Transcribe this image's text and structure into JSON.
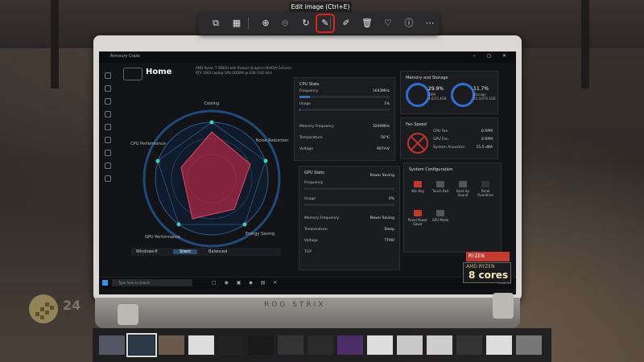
{
  "viewer": {
    "tooltip": "Edit image (Ctrl+E)",
    "toolbar": [
      {
        "name": "visual-search-icon",
        "glyph": "⧉"
      },
      {
        "name": "mosaic-icon",
        "glyph": "▦"
      },
      {
        "name": "zoom-in-icon",
        "glyph": "⊕"
      },
      {
        "name": "zoom-out-icon",
        "glyph": "⊖"
      },
      {
        "name": "rotate-icon",
        "glyph": "↻"
      },
      {
        "name": "edit-image-icon",
        "glyph": "✎"
      },
      {
        "name": "draw-icon",
        "glyph": "✐"
      },
      {
        "name": "delete-icon",
        "glyph": "🗑"
      },
      {
        "name": "favorite-icon",
        "glyph": "♡"
      },
      {
        "name": "info-icon",
        "glyph": "ⓘ"
      },
      {
        "name": "more-icon",
        "glyph": "⋯"
      }
    ],
    "selected_tool": "edit-image-icon",
    "filmstrip_count": 15,
    "filmstrip_current": 1,
    "accent": "#e0221c"
  },
  "photo": {
    "base_text": "ROG STRIX",
    "sticker_top": "AMD RYZEN",
    "sticker_main": "8 cores",
    "red_sticker": "RYZEN"
  },
  "app": {
    "title": "Armoury Crate",
    "page": "Home",
    "spec": "AMD Ryzen 7 5800H with Radeon Graphics NVIDIA GeForce RTX 3060 Laptop GPU GDDR6 @ 6GB (192 bits)",
    "radar_labels": [
      "Cooling",
      "Noise Reduction",
      "Energy Saving",
      "GPU Performance",
      "CPU Performance"
    ],
    "modes": [
      "Windows®",
      "Silent",
      "Balanced"
    ],
    "active_mode": "Silent",
    "cpu": {
      "title": "CPU Stats",
      "frequency_label": "Frequency",
      "frequency": "1643MHz",
      "usage_label": "Usage",
      "usage": "1%",
      "memfreq_label": "Memory Frequency",
      "memfreq": "3200MHz",
      "temp_label": "Temperature",
      "temp": "50°C",
      "volt_label": "Voltage",
      "volt": "907mV"
    },
    "gpu": {
      "title": "GPU Stats",
      "mode": "Power Saving",
      "frequency_label": "Frequency",
      "usage_label": "Usage",
      "usage": "0%",
      "memfreq_label": "Memory Frequency",
      "memfreq": "Power Saving",
      "temp_label": "Temperature",
      "temp": "Sleep",
      "volt_label": "Voltage",
      "volt": "TTMV",
      "tgp_label": "TGP"
    },
    "memory": {
      "title": "Memory and Storage",
      "ram_pct": "29.9%",
      "ram_label": "RAM",
      "ram_detail": "4.6/15.4GB",
      "storage_pct": "11.7%",
      "storage_label": "Storage",
      "storage_detail": "55.4/476.3GB"
    },
    "fan": {
      "title": "Fan Speed",
      "cpu_label": "CPU Fan",
      "cpu": "0 RPM",
      "gpu_label": "GPU Fan",
      "gpu": "0 RPM",
      "acoustics_label": "System Acoustics",
      "acoustics": "15.5 dBA"
    },
    "system": {
      "title": "System Configuration",
      "items": [
        "Win Key",
        "Touch Pad",
        "Boot Up Sound",
        "Panel Overdrive",
        "Panel Power Saver",
        "GPU Mode"
      ]
    },
    "search_placeholder": "Type here to search",
    "clock": "9:41 AM"
  }
}
